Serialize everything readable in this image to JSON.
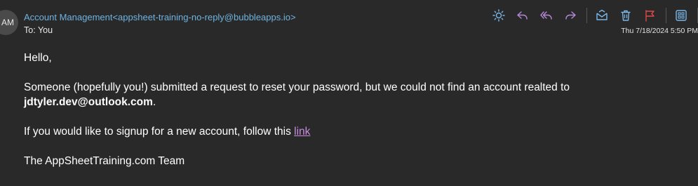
{
  "sender": {
    "avatar_initials": "AM",
    "display": "Account Management<appsheet-training-no-reply@bubbleapps.io>"
  },
  "recipient": {
    "to_label": "To:",
    "to_value": "You"
  },
  "timestamp": "Thu 7/18/2024 5:50 PM",
  "toolbar": {
    "icons": [
      "brightness-icon",
      "reply-icon",
      "reply-all-icon",
      "forward-icon",
      "mark-read-icon",
      "delete-icon",
      "flag-icon",
      "apps-icon",
      "more-icon"
    ]
  },
  "message": {
    "greeting": "Hello,",
    "line1_a": "Someone (hopefully you!) submitted a request to reset your password, but we could not find an account realted to",
    "line1_email": "jdtyler.dev@outlook.com",
    "line1_end": ".",
    "line2_a": "If you would like to signup for a new account, follow this ",
    "line2_link": "link",
    "signature": "The AppSheetTraining.com Team"
  },
  "colors": {
    "background": "#292929",
    "sender": "#6fb3e0",
    "icon_blue": "#7ab8e8",
    "icon_purple": "#b48ad8",
    "icon_red": "#e04848",
    "link": "#c98ee0"
  }
}
